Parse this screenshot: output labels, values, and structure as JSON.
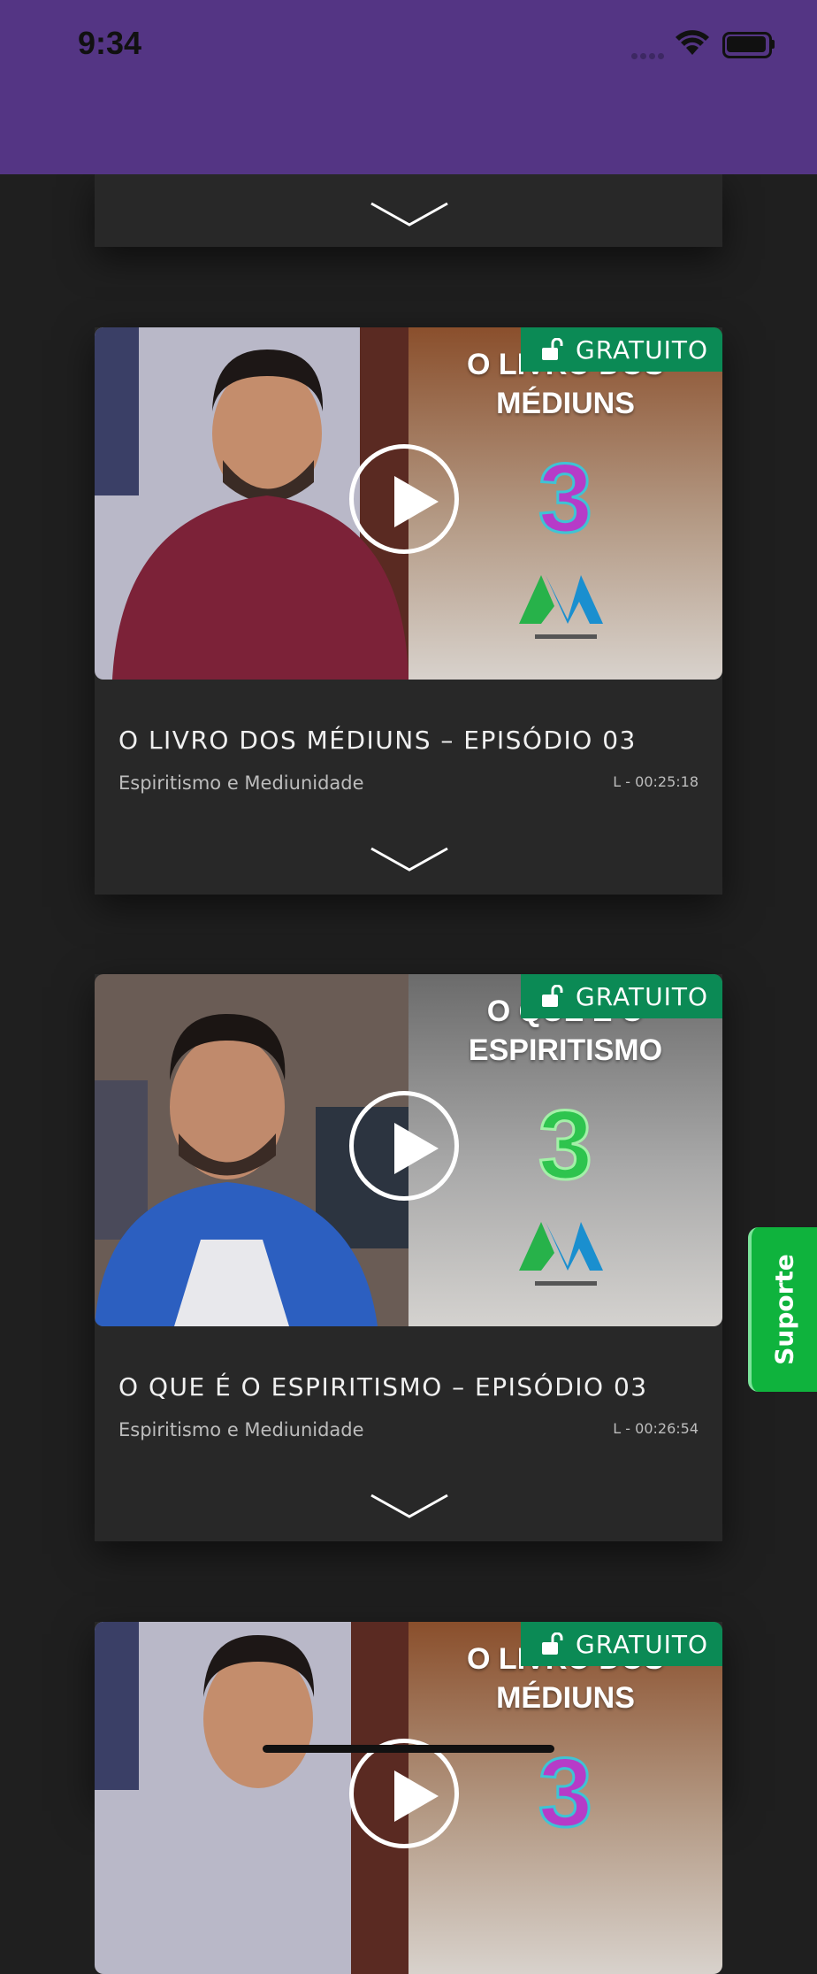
{
  "status_bar": {
    "time": "9:34"
  },
  "colors": {
    "header": "#543584",
    "badge": "#0b8a55",
    "support": "#0fb33d",
    "background": "#1f1f1f",
    "card": "#282828"
  },
  "videos": [
    {
      "badge": "GRATUITO",
      "thumb_title_line1": "O LIVRO DOS",
      "thumb_title_line2": "MÉDIUNS",
      "thumb_number": "3",
      "title": "O LIVRO DOS MÉDIUNS – EPISÓDIO 03",
      "category": "Espiritismo e Mediunidade",
      "duration": "L - 00:25:18"
    },
    {
      "badge": "GRATUITO",
      "thumb_title_line1": "O QUE É O",
      "thumb_title_line2": "ESPIRITISMO",
      "thumb_number": "3",
      "title": "O QUE É O ESPIRITISMO – EPISÓDIO 03",
      "category": "Espiritismo e Mediunidade",
      "duration": "L - 00:26:54"
    },
    {
      "badge": "GRATUITO",
      "thumb_title_line1": "O LIVRO DOS",
      "thumb_title_line2": "MÉDIUNS",
      "thumb_number": "3"
    }
  ],
  "support_button": "Suporte",
  "icons": [
    "wifi-icon",
    "battery-icon",
    "unlock-icon",
    "play-icon",
    "chevron-down-icon"
  ]
}
